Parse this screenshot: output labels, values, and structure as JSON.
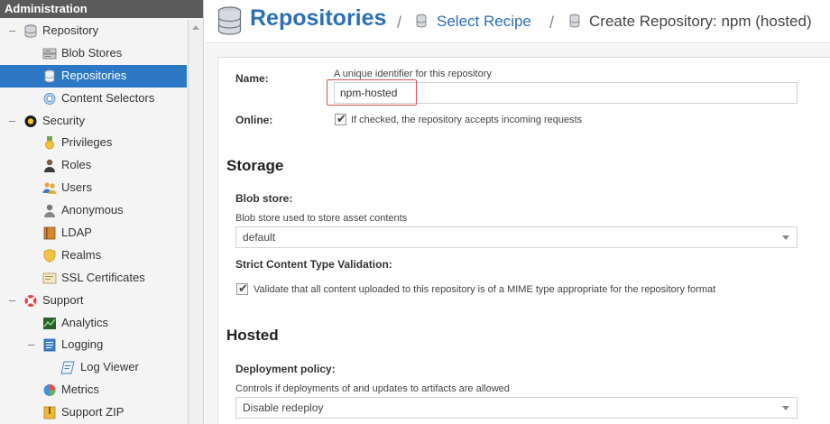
{
  "sidebar": {
    "header": "Administration",
    "items": [
      {
        "label": "Repository",
        "toggle": "–"
      },
      {
        "label": "Blob Stores"
      },
      {
        "label": "Repositories"
      },
      {
        "label": "Content Selectors"
      },
      {
        "label": "Security",
        "toggle": "–"
      },
      {
        "label": "Privileges"
      },
      {
        "label": "Roles"
      },
      {
        "label": "Users"
      },
      {
        "label": "Anonymous"
      },
      {
        "label": "LDAP"
      },
      {
        "label": "Realms"
      },
      {
        "label": "SSL Certificates"
      },
      {
        "label": "Support",
        "toggle": "–"
      },
      {
        "label": "Analytics"
      },
      {
        "label": "Logging",
        "toggle": "–"
      },
      {
        "label": "Log Viewer"
      },
      {
        "label": "Metrics"
      },
      {
        "label": "Support ZIP"
      }
    ]
  },
  "header": {
    "title": "Repositories",
    "separator": "/",
    "crumb_select": "Select Recipe",
    "crumb_current": "Create Repository: npm (hosted)"
  },
  "form": {
    "name_label": "Name:",
    "name_help": "A unique identifier for this repository",
    "name_value": "npm-hosted",
    "online_label": "Online:",
    "online_help": "If checked, the repository accepts incoming requests",
    "storage_title": "Storage",
    "blob_label": "Blob store:",
    "blob_help": "Blob store used to store asset contents",
    "blob_value": "default",
    "strict_label": "Strict Content Type Validation:",
    "strict_help": "Validate that all content uploaded to this repository is of a MIME type appropriate for the repository format",
    "hosted_title": "Hosted",
    "deploy_label": "Deployment policy:",
    "deploy_help": "Controls if deployments of and updates to artifacts are allowed",
    "deploy_value": "Disable redeploy",
    "check_mark": "✔"
  },
  "colors": {
    "accent": "#2c6fb5",
    "selected": "#2c78c5",
    "highlight": "#d9534f"
  }
}
